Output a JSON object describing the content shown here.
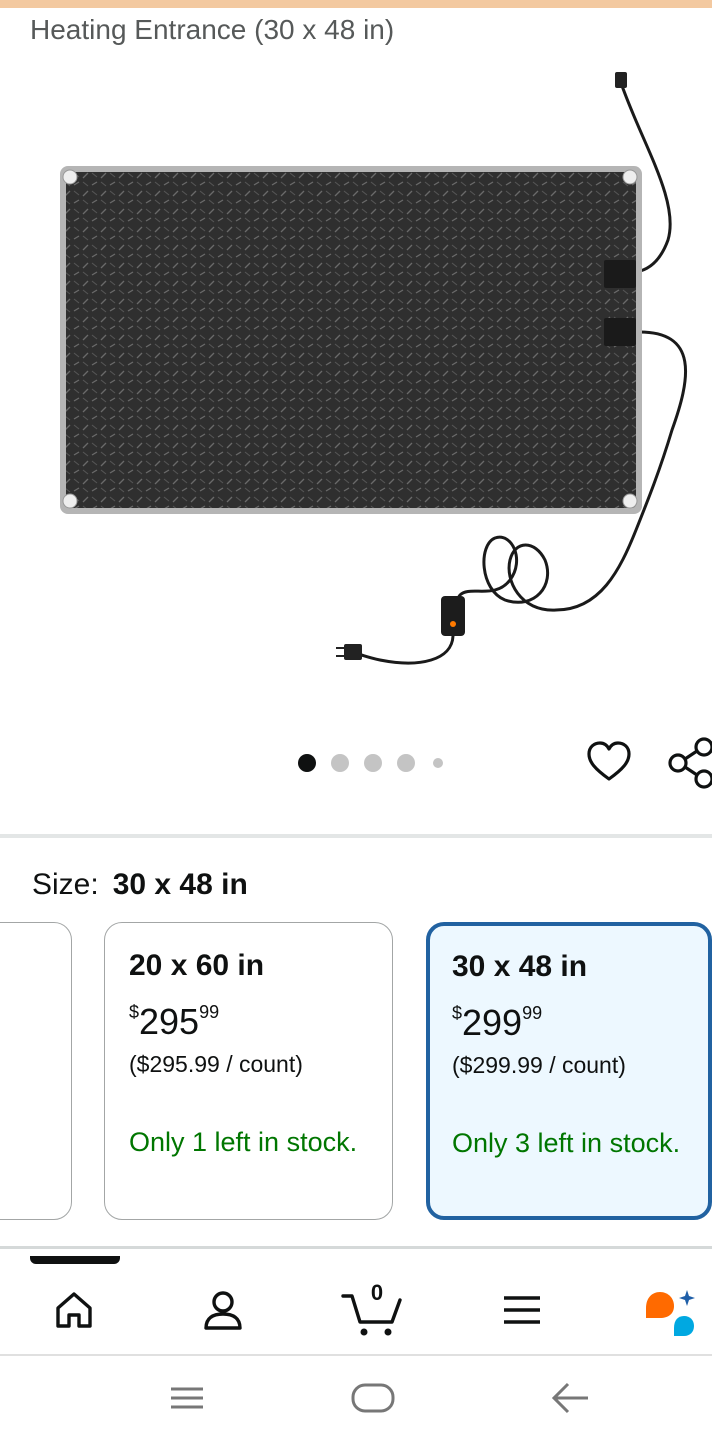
{
  "header": {
    "title_line": "Heating Entrance (30 x 48 in)"
  },
  "gallery": {
    "image": "heated-mat-product-photo",
    "dot_count": 5,
    "active_dot": 1
  },
  "actions": {
    "wishlist_icon": "heart-icon",
    "share_icon": "share-icon"
  },
  "size_selector": {
    "label": "Size:",
    "selected_value": "30 x 48 in",
    "options": [
      {
        "partial_text": ")"
      },
      {
        "size": "20 x 60 in",
        "currency": "$",
        "price_whole": "295",
        "price_fraction": "99",
        "unit_price": "($295.99 / count)",
        "stock": "Only 1 left in stock.",
        "selected": false
      },
      {
        "size": "30 x 48 in",
        "currency": "$",
        "price_whole": "299",
        "price_fraction": "99",
        "unit_price": "($299.99 / count)",
        "stock": "Only 3 left in stock.",
        "selected": true
      }
    ]
  },
  "bottom_nav": {
    "items": [
      "home-icon",
      "account-icon",
      "cart-icon",
      "menu-icon",
      "rufus-assistant-icon"
    ],
    "cart_count": "0"
  },
  "system_nav": {
    "items": [
      "recents-icon",
      "home-pill-icon",
      "back-icon"
    ]
  },
  "colors": {
    "stock_green": "#007600",
    "selected_border": "#2162a1",
    "selected_bg": "#edf8ff",
    "assistant_orange": "#ff6a00",
    "assistant_blue": "#00a8e1"
  }
}
